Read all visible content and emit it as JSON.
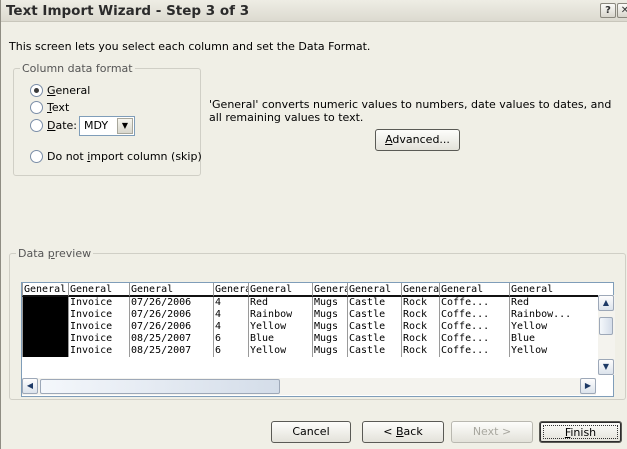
{
  "window": {
    "title": "Text Import Wizard - Step 3 of 3"
  },
  "titlebar": {
    "help_label": "?",
    "close_label": "✕"
  },
  "intro": "This screen lets you select each column and set the Data Format.",
  "column_format": {
    "legend": "Column data format",
    "options": [
      {
        "pre": "",
        "key": "G",
        "post": "eneral",
        "checked": true
      },
      {
        "pre": "",
        "key": "T",
        "post": "ext",
        "checked": false
      },
      {
        "pre": "",
        "key": "D",
        "post": "ate:",
        "checked": false
      },
      {
        "pre": "Do not ",
        "key": "i",
        "post": "mport column (skip)",
        "checked": false
      }
    ],
    "date_value": "MDY"
  },
  "help_text": "'General' converts numeric values to numbers, date values to dates, and all remaining values to text.",
  "advanced": {
    "key": "A",
    "post": "dvanced..."
  },
  "preview": {
    "legend_pre": "Data ",
    "legend_key": "p",
    "legend_post": "review",
    "columns": [
      {
        "header": "General",
        "cells": [
          "",
          "",
          "",
          "",
          ""
        ],
        "selected": true
      },
      {
        "header": "General",
        "cells": [
          "Invoice",
          "Invoice",
          "Invoice",
          "Invoice",
          "Invoice"
        ]
      },
      {
        "header": "General",
        "cells": [
          "07/26/2006",
          "07/26/2006",
          "07/26/2006",
          "08/25/2007",
          "08/25/2007"
        ]
      },
      {
        "header": "General",
        "cells": [
          "4",
          "4",
          "4",
          "6",
          "6"
        ]
      },
      {
        "header": "General",
        "cells": [
          "Red",
          "Rainbow",
          "Yellow",
          "Blue",
          "Yellow"
        ]
      },
      {
        "header": "General",
        "cells": [
          "Mugs",
          "Mugs",
          "Mugs",
          "Mugs",
          "Mugs"
        ]
      },
      {
        "header": "General",
        "cells": [
          "Castle",
          "Castle",
          "Castle",
          "Castle",
          "Castle"
        ]
      },
      {
        "header": "General",
        "cells": [
          "Rock",
          "Rock",
          "Rock",
          "Rock",
          "Rock"
        ]
      },
      {
        "header": "General",
        "cells": [
          "Coffe...",
          "Coffe...",
          "Coffe...",
          "Coffe...",
          "Coffe..."
        ]
      },
      {
        "header": "General",
        "cells": [
          "Red",
          "Rainbow...",
          "Yellow",
          "Blue",
          "Yellow"
        ]
      }
    ]
  },
  "buttons": {
    "cancel": {
      "pre": "",
      "key": "",
      "post": "Cancel"
    },
    "back": {
      "pre": "< ",
      "key": "B",
      "post": "ack"
    },
    "next": {
      "pre": "Next >",
      "key": "",
      "post": ""
    },
    "finish": {
      "pre": "",
      "key": "F",
      "post": "inish"
    }
  },
  "icons": {
    "scroll_up": "arrow-up-icon",
    "scroll_down": "arrow-down-icon",
    "scroll_left": "arrow-left-icon",
    "scroll_right": "arrow-right-icon",
    "dropdown": "chevron-down-icon"
  }
}
